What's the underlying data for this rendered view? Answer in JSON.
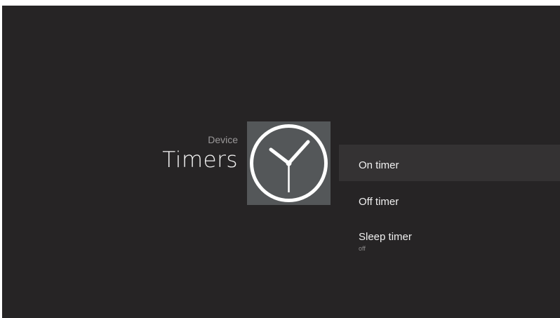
{
  "header": {
    "breadcrumb": "Device",
    "title": "Timers",
    "icon": "clock-icon"
  },
  "menu": {
    "items": [
      {
        "label": "On timer",
        "sub": ""
      },
      {
        "label": "Off timer",
        "sub": ""
      },
      {
        "label": "Sleep timer",
        "sub": "off"
      }
    ]
  },
  "colors": {
    "background": "#262425",
    "focused_row": "#343233",
    "icon_tile": "#545759"
  }
}
